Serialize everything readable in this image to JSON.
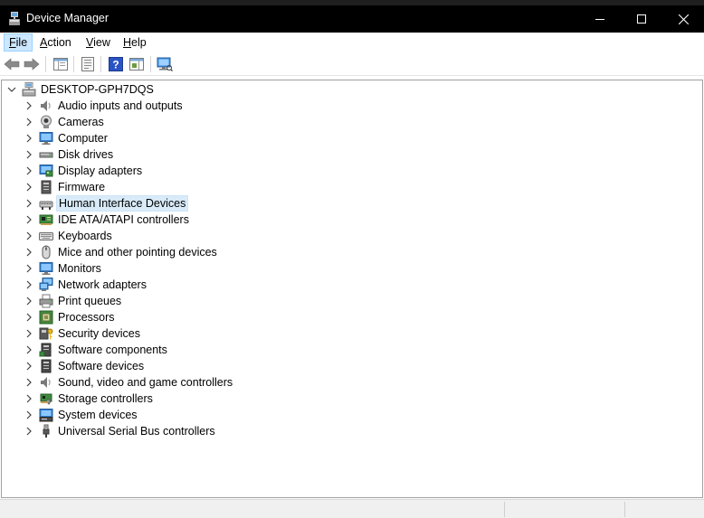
{
  "window": {
    "title": "Device Manager"
  },
  "menu": [
    {
      "label": "File",
      "accel": "F",
      "rest": "ile",
      "active": true
    },
    {
      "label": "Action",
      "accel": "A",
      "rest": "ction",
      "active": false
    },
    {
      "label": "View",
      "accel": "V",
      "rest": "iew",
      "active": false
    },
    {
      "label": "Help",
      "accel": "H",
      "rest": "elp",
      "active": false
    }
  ],
  "tree": {
    "root": "DESKTOP-GPH7DQS",
    "categories": [
      {
        "label": "Audio inputs and outputs",
        "icon": "speaker-icon"
      },
      {
        "label": "Cameras",
        "icon": "camera-icon"
      },
      {
        "label": "Computer",
        "icon": "computer-icon"
      },
      {
        "label": "Disk drives",
        "icon": "disk-drive-icon"
      },
      {
        "label": "Display adapters",
        "icon": "display-adapter-icon"
      },
      {
        "label": "Firmware",
        "icon": "firmware-icon"
      },
      {
        "label": "Human Interface Devices",
        "icon": "hid-icon",
        "selected": true
      },
      {
        "label": "IDE ATA/ATAPI controllers",
        "icon": "ide-controller-icon"
      },
      {
        "label": "Keyboards",
        "icon": "keyboard-icon"
      },
      {
        "label": "Mice and other pointing devices",
        "icon": "mouse-icon"
      },
      {
        "label": "Monitors",
        "icon": "monitor-icon"
      },
      {
        "label": "Network adapters",
        "icon": "network-adapter-icon"
      },
      {
        "label": "Print queues",
        "icon": "printer-icon"
      },
      {
        "label": "Processors",
        "icon": "processor-icon"
      },
      {
        "label": "Security devices",
        "icon": "security-device-icon"
      },
      {
        "label": "Software components",
        "icon": "software-component-icon"
      },
      {
        "label": "Software devices",
        "icon": "software-device-icon"
      },
      {
        "label": "Sound, video and game controllers",
        "icon": "sound-controller-icon"
      },
      {
        "label": "Storage controllers",
        "icon": "storage-controller-icon"
      },
      {
        "label": "System devices",
        "icon": "system-devices-icon"
      },
      {
        "label": "Universal Serial Bus controllers",
        "icon": "usb-icon"
      }
    ]
  },
  "colors": {
    "titlebar": "#000000",
    "selection": "#d9ebf9",
    "menu_active": "#cce8ff"
  }
}
